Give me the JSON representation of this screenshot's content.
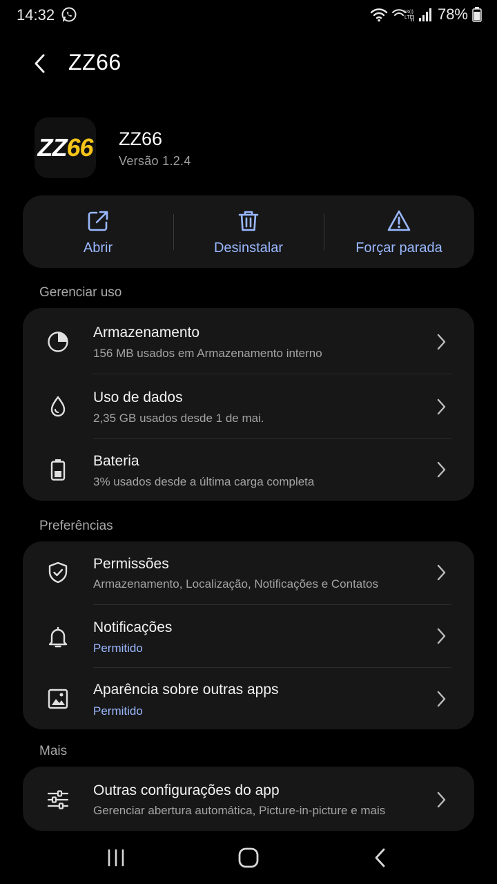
{
  "status_bar": {
    "time": "14:32",
    "battery": "78%",
    "notification_icon": "whatsapp-icon",
    "icons": [
      "wifi-icon",
      "volte-signal-icon",
      "signal-icon",
      "battery-icon"
    ]
  },
  "app_bar": {
    "title": "ZZ66",
    "back_icon": "chevron-left-icon"
  },
  "app": {
    "logo_zz": "ZZ",
    "logo_66": "66",
    "name": "ZZ66",
    "version": "Versão 1.2.4"
  },
  "actions": [
    {
      "label": "Abrir",
      "icon": "open-external-icon"
    },
    {
      "label": "Desinstalar",
      "icon": "trash-icon"
    },
    {
      "label": "Forçar parada",
      "icon": "warning-icon"
    }
  ],
  "sections": {
    "usage": {
      "title": "Gerenciar uso",
      "items": [
        {
          "title": "Armazenamento",
          "subtitle": "156 MB usados em Armazenamento interno",
          "icon": "storage-pie-icon"
        },
        {
          "title": "Uso de dados",
          "subtitle": "2,35 GB usados desde 1 de mai.",
          "icon": "data-drop-icon"
        },
        {
          "title": "Bateria",
          "subtitle": "3% usados desde a última carga completa",
          "icon": "battery-icon"
        }
      ]
    },
    "preferences": {
      "title": "Preferências",
      "items": [
        {
          "title": "Permissões",
          "subtitle": "Armazenamento, Localização, Notificações e Contatos",
          "icon": "shield-check-icon"
        },
        {
          "title": "Notificações",
          "subtitle": "Permitido",
          "icon": "bell-icon"
        },
        {
          "title": "Aparência sobre outras apps",
          "subtitle": "Permitido",
          "icon": "image-overlay-icon"
        }
      ]
    },
    "more": {
      "title": "Mais",
      "items": [
        {
          "title": "Outras configurações do app",
          "subtitle": "Gerenciar abertura automática, Picture-in-picture e mais",
          "icon": "sliders-icon"
        }
      ]
    }
  },
  "colors": {
    "background": "#000000",
    "card": "#171717",
    "accent": "#9ab8ff",
    "logo_yellow": "#f5c518"
  },
  "nav_bar": {
    "icons": [
      "recents-icon",
      "home-icon",
      "back-icon"
    ]
  }
}
